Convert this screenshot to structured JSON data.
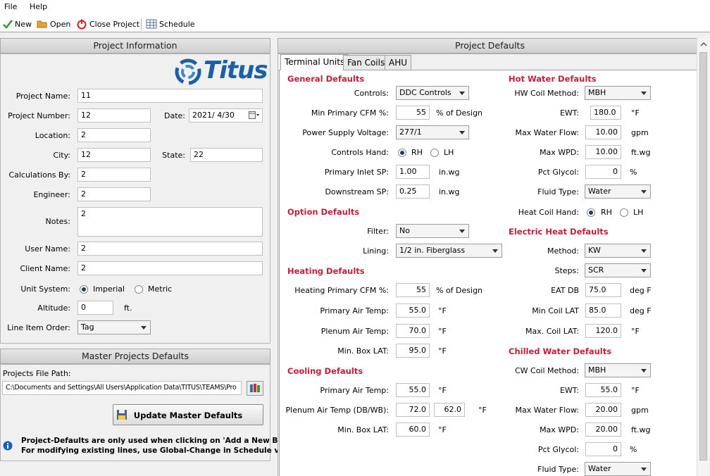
{
  "menu": {
    "file": "File",
    "help": "Help"
  },
  "toolbar": {
    "new": "New",
    "open": "Open",
    "close_project": "Close Project",
    "schedule": "Schedule"
  },
  "project_info": {
    "title": "Project Information",
    "logo_text": "Titus",
    "project_name_label": "Project Name:",
    "project_name": "11",
    "project_number_label": "Project Number:",
    "project_number": "12",
    "date_label": "Date:",
    "date": "2021/ 4/30",
    "location_label": "Location:",
    "location": "2",
    "city_label": "City:",
    "city": "12",
    "state_label": "State:",
    "state": "22",
    "calc_by_label": "Calculations By:",
    "calc_by": "2",
    "engineer_label": "Engineer:",
    "engineer": "2",
    "notes_label": "Notes:",
    "notes": "2",
    "user_name_label": "User Name:",
    "user_name": "2",
    "client_name_label": "Client Name:",
    "client_name": "2",
    "unit_system_label": "Unit System:",
    "imperial": "Imperial",
    "metric": "Metric",
    "altitude_label": "Altitude:",
    "altitude": "0",
    "altitude_unit": "ft.",
    "line_item_order_label": "Line Item Order:",
    "line_item_order": "Tag"
  },
  "master": {
    "title": "Master Projects Defaults",
    "path_label": "Projects File Path:",
    "path": "C:\\Documents and Settings\\All Users\\Application Data\\TITUS\\TEAMS\\Pro",
    "update_button": "Update Master Defaults",
    "note1": "Project-Defaults are only used when clicking on 'Add a New Box'.",
    "note2": "For modifying existing lines, use Global-Change in Schedule view."
  },
  "defaults": {
    "title": "Project Defaults",
    "tabs": [
      "Terminal Units",
      "Fan Coils",
      "AHU"
    ],
    "general": {
      "title": "General Defaults",
      "controls_label": "Controls:",
      "controls": "DDC Controls",
      "min_primary_label": "Min Primary CFM %:",
      "min_primary": "55",
      "min_primary_unit": "% of Design",
      "psv_label": "Power Supply Voltage:",
      "psv": "277/1",
      "hand_label": "Controls Hand:",
      "rh": "RH",
      "lh": "LH",
      "inlet_sp_label": "Primary Inlet SP:",
      "inlet_sp": "1.00",
      "inlet_sp_unit": "in.wg",
      "down_sp_label": "Downstream SP:",
      "down_sp": "0.25",
      "down_sp_unit": "in.wg"
    },
    "option": {
      "title": "Option Defaults",
      "filter_label": "Filter:",
      "filter": "No",
      "lining_label": "Lining:",
      "lining": "1/2 in. Fiberglass"
    },
    "heating": {
      "title": "Heating Defaults",
      "primary_label": "Heating Primary CFM %:",
      "primary": "55",
      "primary_unit": "% of Design",
      "pat_label": "Primary Air Temp:",
      "pat": "55.0",
      "pat_unit": "°F",
      "plenum_label": "Plenum Air Temp:",
      "plenum": "70.0",
      "plenum_unit": "°F",
      "minlat_label": "Min. Box LAT:",
      "minlat": "95.0",
      "minlat_unit": "°F"
    },
    "cooling": {
      "title": "Cooling Defaults",
      "pat_label": "Primary Air Temp:",
      "pat": "55.0",
      "pat_unit": "°F",
      "plenum_label": "Plenum Air Temp (DB/WB):",
      "plenum_db": "72.0",
      "plenum_wb": "62.0",
      "plenum_unit": "°F",
      "minlat_label": "Min. Box LAT:",
      "minlat": "60.0",
      "minlat_unit": "°F"
    },
    "hot_water": {
      "title": "Hot Water Defaults",
      "method_label": "HW Coil Method:",
      "method": "MBH",
      "ewt_label": "EWT:",
      "ewt": "180.0",
      "ewt_unit": "°F",
      "flow_label": "Max Water Flow:",
      "flow": "10.00",
      "flow_unit": "gpm",
      "wpd_label": "Max WPD:",
      "wpd": "10.00",
      "wpd_unit": "ft.wg",
      "glycol_label": "Pct Glycol:",
      "glycol": "0",
      "glycol_unit": "%",
      "fluid_label": "Fluid Type:",
      "fluid": "Water",
      "hand_label": "Heat Coil Hand:",
      "rh": "RH",
      "lh": "LH"
    },
    "electric": {
      "title": "Electric Heat Defaults",
      "method_label": "Method:",
      "method": "KW",
      "steps_label": "Steps:",
      "steps": "SCR",
      "eat_label": "EAT DB",
      "eat": "75.0",
      "eat_unit": "deg F",
      "min_lat_label": "Min Coil LAT",
      "min_lat": "85.0",
      "min_lat_unit": "deg F",
      "max_lat_label": "Max. Coil LAT:",
      "max_lat": "120.0",
      "max_lat_unit": "°F"
    },
    "chilled": {
      "title": "Chilled Water Defaults",
      "method_label": "CW Coil Method:",
      "method": "MBH",
      "ewt_label": "EWT:",
      "ewt": "55.0",
      "ewt_unit": "°F",
      "flow_label": "Max Water Flow:",
      "flow": "20.00",
      "flow_unit": "gpm",
      "wpd_label": "Max WPD:",
      "wpd": "20.00",
      "wpd_unit": "ft.wg",
      "glycol_label": "Pct Glycol:",
      "glycol": "0",
      "glycol_unit": "%",
      "fluid_label": "Fluid Type:",
      "fluid": "Water"
    }
  },
  "colors": {
    "section_title": "#c0203a",
    "logo_blue": "#1a5fa8"
  }
}
